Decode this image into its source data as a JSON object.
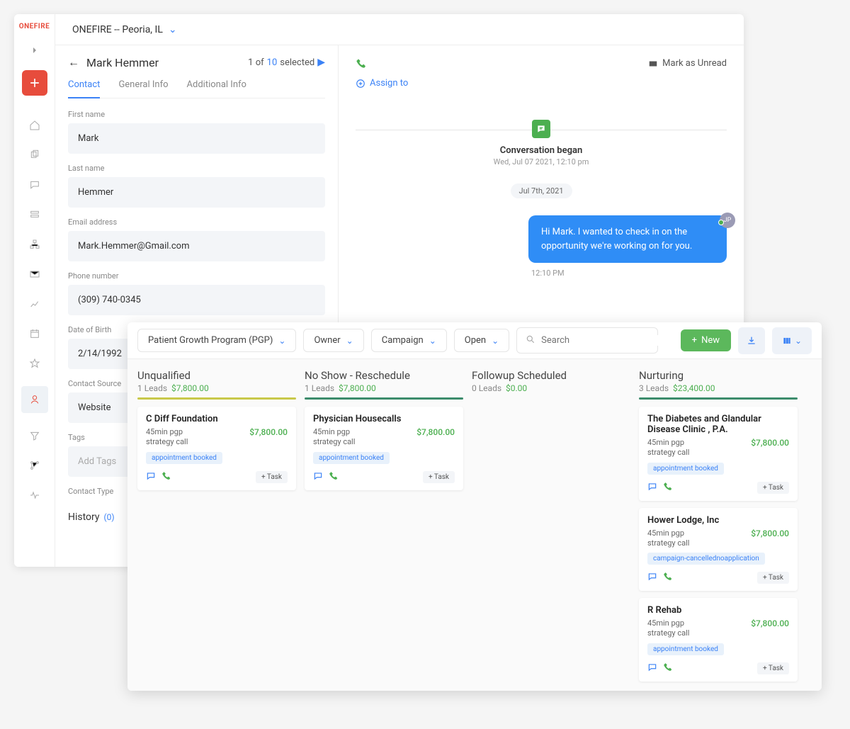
{
  "sidebar": {
    "logo": "ONEFIRE"
  },
  "topbar": {
    "org": "ONEFIRE -- Peoria, IL"
  },
  "contact_panel": {
    "name": "Mark Hemmer",
    "position": "1 of",
    "total": "10",
    "selected_label": "selected",
    "tabs": {
      "contact": "Contact",
      "general": "General Info",
      "additional": "Additional Info"
    },
    "fields": {
      "first_name": {
        "label": "First name",
        "value": "Mark"
      },
      "last_name": {
        "label": "Last name",
        "value": "Hemmer"
      },
      "email": {
        "label": "Email address",
        "value": "Mark.Hemmer@Gmail.com"
      },
      "phone": {
        "label": "Phone number",
        "value": "(309) 740-0345"
      },
      "dob": {
        "label": "Date of Birth",
        "value": "2/14/1992"
      },
      "source": {
        "label": "Contact Source",
        "value": "Website"
      },
      "tags": {
        "label": "Tags",
        "placeholder": "Add Tags"
      },
      "type": {
        "label": "Contact Type"
      }
    },
    "history": {
      "label": "History",
      "count": "(0)"
    }
  },
  "conversation": {
    "assign": "Assign to",
    "mark_unread": "Mark as Unread",
    "began_label": "Conversation began",
    "began_date": "Wed, Jul 07 2021, 12:10 pm",
    "date_pill": "Jul 7th, 2021",
    "message": "Hi Mark. I wanted to check in on the opportunity we're working on for you.",
    "time": "12:10 PM",
    "avatar_initials": "JP"
  },
  "kanban": {
    "filters": {
      "program": "Patient Growth Program (PGP)",
      "owner": "Owner",
      "campaign": "Campaign",
      "status": "Open"
    },
    "search_placeholder": "Search",
    "new_label": "New",
    "columns": [
      {
        "title": "Unqualified",
        "leads": "1 Leads",
        "total": "$7,800.00",
        "bar": "bar-yellow",
        "cards": [
          {
            "title": "C Diff Foundation",
            "meta1": "45min pgp",
            "meta2": "strategy call",
            "price": "$7,800.00",
            "tag": "appointment booked"
          }
        ]
      },
      {
        "title": "No Show - Reschedule",
        "leads": "1 Leads",
        "total": "$7,800.00",
        "bar": "bar-green",
        "cards": [
          {
            "title": "Physician Housecalls",
            "meta1": "45min pgp",
            "meta2": "strategy call",
            "price": "$7,800.00",
            "tag": "appointment booked"
          }
        ]
      },
      {
        "title": "Followup Scheduled",
        "leads": "0 Leads",
        "total": "$0.00",
        "bar": "",
        "cards": []
      },
      {
        "title": "Nurturing",
        "leads": "3 Leads",
        "total": "$23,400.00",
        "bar": "bar-teal",
        "cards": [
          {
            "title": "The Diabetes and Glandular Disease Clinic , P.A.",
            "meta1": "45min pgp",
            "meta2": "strategy call",
            "price": "$7,800.00",
            "tag": "appointment booked"
          },
          {
            "title": "Hower Lodge, Inc",
            "meta1": "45min pgp",
            "meta2": "strategy call",
            "price": "$7,800.00",
            "tag": "campaign-cancellednoapplication"
          },
          {
            "title": "R Rehab",
            "meta1": "45min pgp",
            "meta2": "strategy call",
            "price": "$7,800.00",
            "tag": "appointment booked"
          }
        ]
      }
    ],
    "task_label": "+ Task"
  }
}
